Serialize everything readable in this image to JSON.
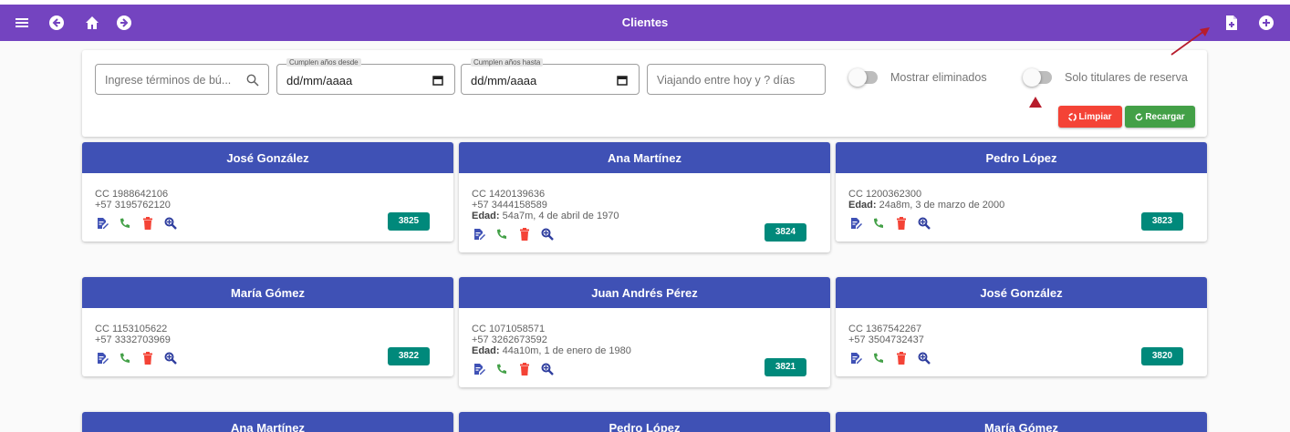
{
  "toolbar": {
    "title": "Clientes",
    "left_icons": [
      "menu-icon",
      "back-icon",
      "home-icon",
      "forward-icon"
    ],
    "right_icons": [
      "new-document-icon",
      "add-circle-icon"
    ],
    "color": "#7444c0"
  },
  "filters": {
    "search_placeholder": "Ingrese términos de bú...",
    "birthday_from_label": "Cumplen años desde",
    "birthday_from_value": "dd/mm/aaaa",
    "birthday_to_label": "Cumplen años hasta",
    "birthday_to_value": "dd/mm/aaaa",
    "traveling_placeholder": "Viajando entre hoy y ? días",
    "show_deleted_label": "Mostrar eliminados",
    "only_holders_label": "Solo titulares de reserva",
    "clear_label": "Limpiar",
    "reload_label": "Recargar"
  },
  "colors": {
    "card_header": "#3f51b5",
    "badge": "#00897b",
    "edit_icon": "#3f51b5",
    "phone_icon": "#43a047",
    "delete_icon": "#f44336",
    "search_icon": "#303f9f",
    "annotation": "#b71c2c"
  },
  "clients": [
    {
      "name": "José González",
      "lines": [
        "CC 1988642106",
        "+57 3195762120"
      ],
      "age_label": "",
      "age": "",
      "id": "3825"
    },
    {
      "name": "Ana Martínez",
      "lines": [
        "CC 1420139636",
        "+57 3444158589"
      ],
      "age_label": "Edad:",
      "age": " 54a7m, 4 de abril de 1970",
      "id": "3824"
    },
    {
      "name": "Pedro López",
      "lines": [
        "CC 1200362300"
      ],
      "age_label": "Edad:",
      "age": " 24a8m, 3 de marzo de 2000",
      "id": "3823"
    },
    {
      "name": "María Gómez",
      "lines": [
        "CC 1153105622",
        "+57 3332703969"
      ],
      "age_label": "",
      "age": "",
      "id": "3822"
    },
    {
      "name": "Juan Andrés Pérez",
      "lines": [
        "CC 1071058571",
        "+57 3262673592"
      ],
      "age_label": "Edad:",
      "age": " 44a10m, 1 de enero de 1980",
      "id": "3821"
    },
    {
      "name": "José González",
      "lines": [
        "CC 1367542267",
        "+57 3504732437"
      ],
      "age_label": "",
      "age": "",
      "id": "3820"
    },
    {
      "name": "Ana Martínez",
      "lines": [],
      "age_label": "",
      "age": "",
      "id": ""
    },
    {
      "name": "Pedro López",
      "lines": [],
      "age_label": "",
      "age": "",
      "id": ""
    },
    {
      "name": "María Gómez",
      "lines": [],
      "age_label": "",
      "age": "",
      "id": ""
    }
  ]
}
